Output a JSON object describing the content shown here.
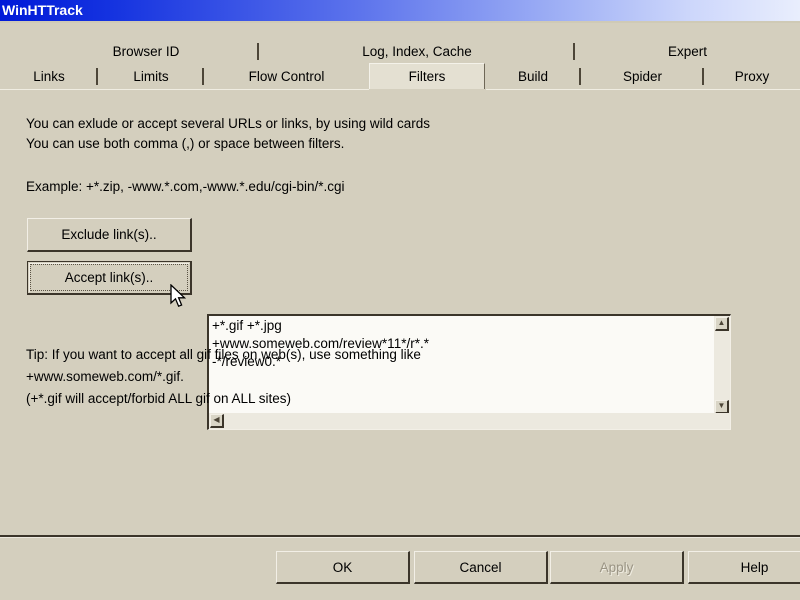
{
  "window": {
    "title": "WinHTTrack",
    "titlebar_gradient_start": "#0019d8",
    "titlebar_gradient_end": "#e9eefd",
    "face_color": "#d4cfbe"
  },
  "tabs": {
    "top_row": [
      {
        "label": "Browser ID"
      },
      {
        "label": "Log, Index, Cache"
      },
      {
        "label": "Expert"
      }
    ],
    "bottom_row": [
      {
        "label": "Links",
        "selected": false
      },
      {
        "label": "Limits",
        "selected": false
      },
      {
        "label": "Flow Control",
        "selected": false
      },
      {
        "label": "Filters",
        "selected": true
      },
      {
        "label": "Build",
        "selected": false
      },
      {
        "label": "Spider",
        "selected": false
      },
      {
        "label": "Proxy",
        "selected": false
      }
    ],
    "selected": "Filters"
  },
  "panel": {
    "intro_line1": "You can exlude or accept several URLs or links, by using wild cards",
    "intro_line2": "You can use both comma (,) or space between filters.",
    "example_line": "Example: +*.zip, -www.*.com,-www.*.edu/cgi-bin/*.cgi",
    "exclude_button": "Exclude link(s)..",
    "accept_button": "Accept link(s)..",
    "filters_value": "+*.gif +*.jpg\n+www.someweb.com/review*11*/r*.*\n-*/review0.*",
    "tip_line1": "Tip: If you want to accept all gif files on web(s), use something like",
    "tip_line2": "+www.someweb.com/*.gif.",
    "tip_line3": "(+*.gif will accept/forbid ALL gif on ALL sites)",
    "scroll_up_glyph": "▲",
    "scroll_down_glyph": "▼",
    "scroll_left_glyph": "◀",
    "scroll_right_glyph": "▶"
  },
  "footer": {
    "ok": "OK",
    "cancel": "Cancel",
    "apply": "Apply",
    "apply_disabled": true,
    "help": "Help"
  }
}
